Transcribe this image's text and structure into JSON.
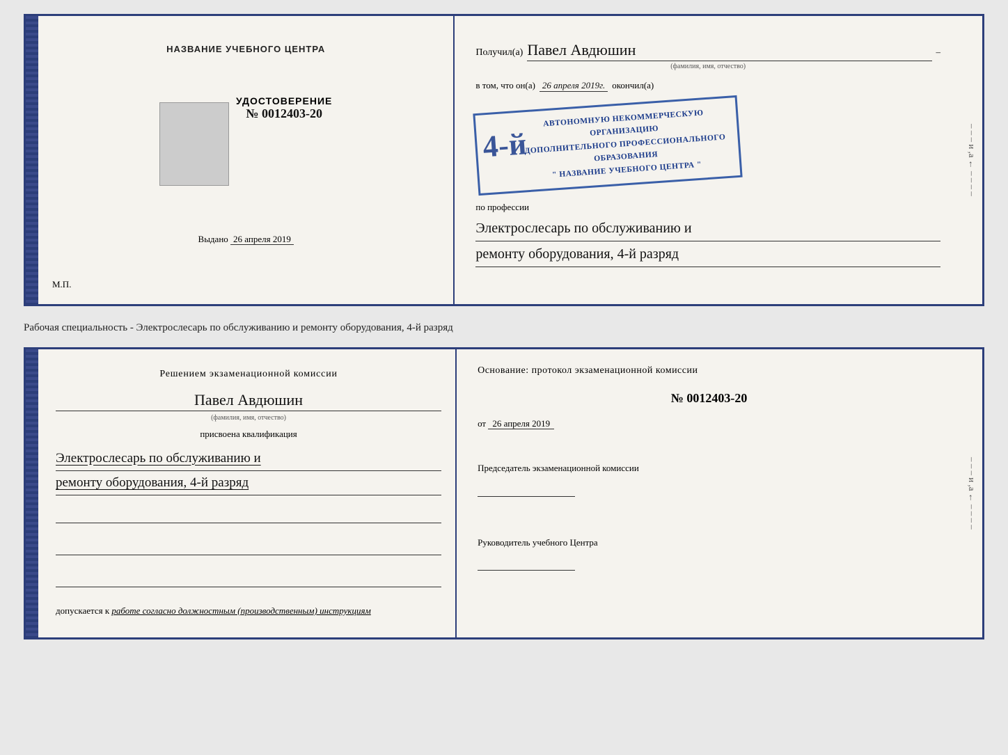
{
  "top_document": {
    "left": {
      "title": "НАЗВАНИЕ УЧЕБНОГО ЦЕНТРА",
      "udostoverenie_label": "УДОСТОВЕРЕНИЕ",
      "number": "№ 0012403-20",
      "vydano_label": "Выдано",
      "vydano_date": "26 апреля 2019",
      "mp_label": "М.П."
    },
    "right": {
      "poluchil_label": "Получил(a)",
      "name": "Павел Авдюшин",
      "name_subtitle": "(фамилия, имя, отчество)",
      "vtom_label": "в том, что он(а)",
      "date": "26 апреля 2019г.",
      "okonchil_label": "окончил(а)",
      "stamp_digit": "4-й",
      "stamp_line1": "АВТОНОМНУЮ НЕКОММЕРЧЕСКУЮ ОРГАНИЗАЦИЮ",
      "stamp_line2": "ДОПОЛНИТЕЛЬНОГО ПРОФЕССИОНАЛЬНОГО ОБРАЗОВАНИЯ",
      "stamp_line3": "\" НАЗВАНИЕ УЧЕБНОГО ЦЕНТРА \"",
      "po_professii_label": "по профессии",
      "profession_line1": "Электрослесарь по обслуживанию и",
      "profession_line2": "ремонту оборудования, 4-й разряд"
    }
  },
  "middle": {
    "text": "Рабочая специальность - Электрослесарь по обслуживанию и ремонту оборудования, 4-й разряд"
  },
  "bottom_document": {
    "left": {
      "resheniem_label": "Решением экзаменационной комиссии",
      "name": "Павел Авдюшин",
      "name_subtitle": "(фамилия, имя, отчество)",
      "prisvoena_label": "присвоена квалификация",
      "qualification_line1": "Электрослесарь по обслуживанию и",
      "qualification_line2": "ремонту оборудования, 4-й разряд",
      "dopuskaetsya_label": "допускается к",
      "dopuskaetsya_text": "работе согласно должностным (производственным) инструкциям"
    },
    "right": {
      "osnovanie_label": "Основание: протокол экзаменационной комиссии",
      "number": "№ 0012403-20",
      "ot_label": "от",
      "ot_date": "26 апреля 2019",
      "predsedatel_label": "Председатель экзаменационной комиссии",
      "rukovoditel_label": "Руководитель учебного Центра"
    },
    "right_decorations": [
      "–",
      "–",
      "–",
      "и",
      ",а",
      "←",
      "–",
      "–",
      "–",
      "–"
    ]
  }
}
